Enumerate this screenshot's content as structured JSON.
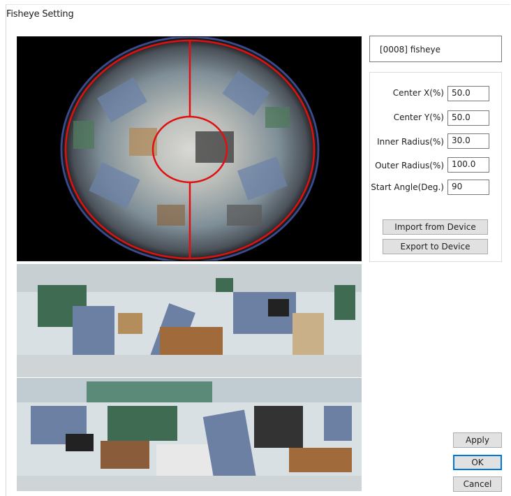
{
  "window": {
    "title": "Fisheye Setting"
  },
  "device": {
    "label": "[0008] fisheye"
  },
  "settings": {
    "fields": [
      {
        "label": "Center X(%)",
        "value": "50.0"
      },
      {
        "label": "Center Y(%)",
        "value": "50.0"
      },
      {
        "label": "Inner Radius(%)",
        "value": "30.0"
      },
      {
        "label": "Outer Radius(%)",
        "value": "100.0"
      },
      {
        "label": "Start Angle(Deg.)",
        "value": "90"
      }
    ],
    "import_label": "Import from Device",
    "export_label": "Export to Device"
  },
  "buttons": {
    "apply": "Apply",
    "ok": "OK",
    "cancel": "Cancel"
  },
  "colors": {
    "overlay": "#e01010",
    "accent": "#0078d7"
  }
}
